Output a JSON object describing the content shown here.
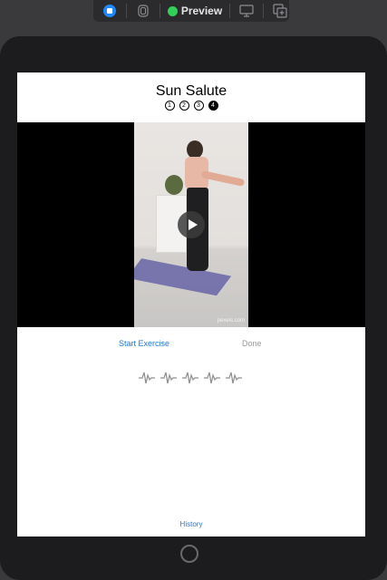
{
  "toolbar": {
    "preview_label": "Preview",
    "icons": [
      "live-icon",
      "device-icon",
      "preview-status-icon",
      "device-settings-icon",
      "duplicate-icon"
    ]
  },
  "app": {
    "title": "Sun Salute",
    "steps": [
      {
        "label": "1",
        "active": false
      },
      {
        "label": "2",
        "active": false
      },
      {
        "label": "3",
        "active": false
      },
      {
        "label": "4",
        "active": true
      }
    ],
    "video": {
      "watermark": "pexels.com"
    },
    "actions": {
      "start_label": "Start Exercise",
      "done_label": "Done"
    },
    "history_label": "History"
  },
  "colors": {
    "accent": "#1d7ad8",
    "disabled": "#9a9a9a",
    "live_button": "#1e88ff",
    "status_green": "#30d158"
  }
}
